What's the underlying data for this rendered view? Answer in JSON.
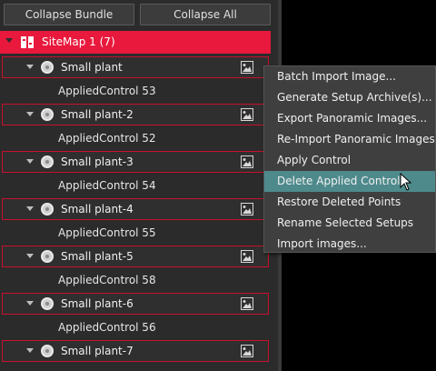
{
  "toolbar": {
    "collapse_bundle": "Collapse Bundle",
    "collapse_all": "Collapse All"
  },
  "tree": {
    "root_label": "SiteMap 1 (7)",
    "items": [
      {
        "label": "Small plant",
        "child": "AppliedControl 53"
      },
      {
        "label": "Small plant-2",
        "child": "AppliedControl 52"
      },
      {
        "label": "Small plant-3",
        "child": "AppliedControl 54"
      },
      {
        "label": "Small plant-4",
        "child": "AppliedControl 55"
      },
      {
        "label": "Small plant-5",
        "child": "AppliedControl 58"
      },
      {
        "label": "Small plant-6",
        "child": "AppliedControl 56"
      },
      {
        "label": "Small plant-7",
        "child": ""
      }
    ]
  },
  "context_menu": {
    "items": [
      "Batch Import Image...",
      "Generate Setup Archive(s)...",
      "Export Panoramic Images...",
      "Re-Import Panoramic Images...",
      "Apply Control",
      "Delete Applied Control",
      "Restore Deleted Points",
      "Rename Selected Setups",
      "Import images..."
    ],
    "highlighted": "Delete Applied Control"
  },
  "colors": {
    "accent_red": "#e8193c",
    "highlight": "#4e8a8c",
    "background": "#2b2b2b"
  },
  "icons": {
    "root": "sitemap-book-icon",
    "node": "setup-node-icon",
    "image": "image-icon"
  }
}
